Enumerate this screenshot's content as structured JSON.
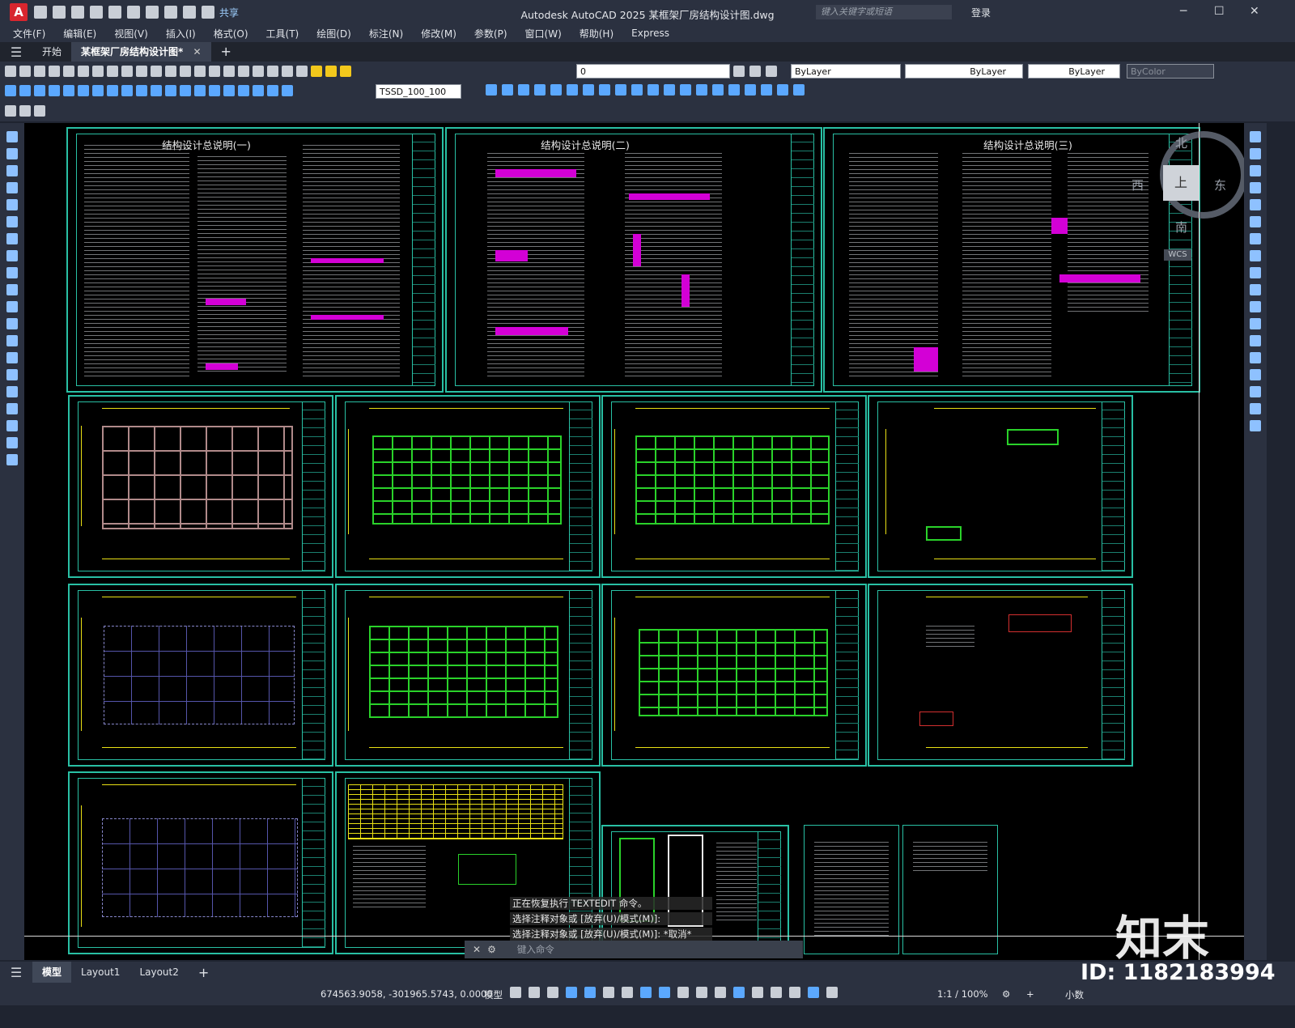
{
  "app": {
    "logo_letter": "A",
    "share_label": "共享",
    "title": "Autodesk AutoCAD 2025    某框架厂房结构设计图.dwg",
    "search_placeholder": "键入关键字或短语",
    "login_label": "登录"
  },
  "menu": [
    "文件(F)",
    "编辑(E)",
    "视图(V)",
    "插入(I)",
    "格式(O)",
    "工具(T)",
    "绘图(D)",
    "标注(N)",
    "修改(M)",
    "参数(P)",
    "窗口(W)",
    "帮助(H)",
    "Express"
  ],
  "doc_tabs": {
    "start": "开始",
    "active": "某框架厂房结构设计图*",
    "close": "✕",
    "add": "+"
  },
  "layer_controls": {
    "layer": "0",
    "color": "ByLayer",
    "linetype": "ByLayer",
    "lineweight": "ByLayer",
    "plotstyle": "ByColor",
    "dimstyle": "TSSD_100_100"
  },
  "sheets": {
    "s1_title": "结构设计总说明(一)",
    "s2_title": "结构设计总说明(二)",
    "s3_title": "结构设计总说明(三)"
  },
  "viewcube": {
    "north": "北",
    "south": "南",
    "west": "西",
    "east": "东",
    "top": "上",
    "wcs": "WCS"
  },
  "command_history": [
    "正在恢复执行 TEXTEDIT 命令。",
    "选择注释对象或 [放弃(U)/模式(M)]:",
    "选择注释对象或 [放弃(U)/模式(M)]: *取消*"
  ],
  "command_placeholder": "键入命令",
  "layout_tabs": [
    "模型",
    "Layout1",
    "Layout2"
  ],
  "status": {
    "coords": "674563.9058, -301965.5743, 0.0000",
    "model": "模型",
    "scale": "1:1 / 100%",
    "units": "小数"
  },
  "watermark": {
    "logo_text": "知末",
    "id_text": "ID: 1182183994"
  },
  "colors": {
    "accent": "#29c0a4",
    "plan_green": "#2ad22a",
    "yellow": "#e9e015",
    "magenta": "#d300d6"
  }
}
